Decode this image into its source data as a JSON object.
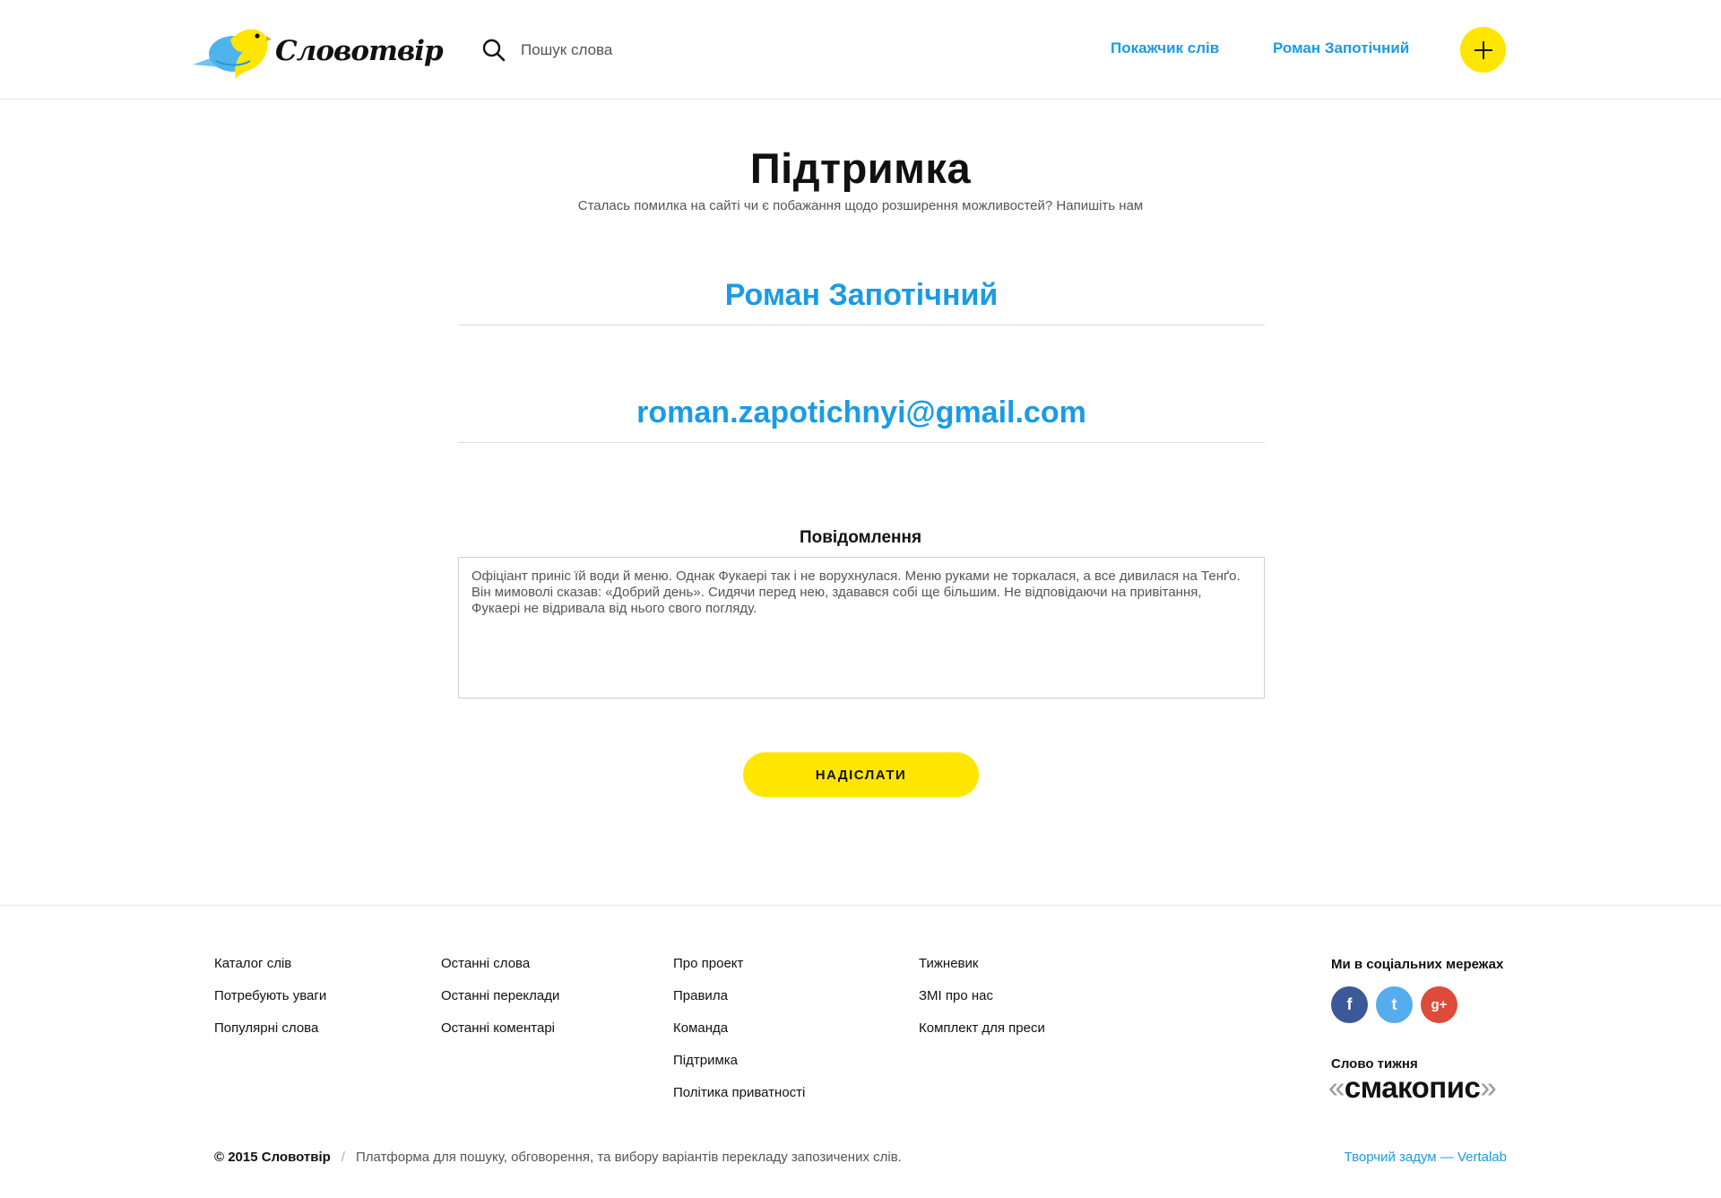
{
  "header": {
    "logo_text": "Словотвір",
    "search": {
      "placeholder": "Пошук слова",
      "value": ""
    },
    "nav": {
      "index_link": "Покажчик слів",
      "user_link": "Роман Запотічний"
    }
  },
  "main": {
    "title": "Підтримка",
    "subtitle": "Сталась помилка на сайті чи є побажання щодо розширення можливостей? Напишіть нам",
    "name_value": "Роман Запотічний",
    "email_value": "roman.zapotichnyi@gmail.com",
    "message_label": "Повідомлення",
    "message_value": "Офіціант приніс їй води й меню. Однак Фукаері так і не ворухнулася. Меню руками не торкалася, а все дивилася на Тенґо. Він мимоволі сказав: «Добрий день». Сидячи перед нею, здавався собі ще більшим. Не відповідаючи на привітання, Фукаері не відривала від нього свого погляду.",
    "submit_label": "НАДІСЛАТИ"
  },
  "footer": {
    "col1": [
      "Каталог слів",
      "Потребують уваги",
      "Популярні слова"
    ],
    "col2": [
      "Останні слова",
      "Останні переклади",
      "Останні коментарі"
    ],
    "col3": [
      "Про проект",
      "Правила",
      "Команда",
      "Підтримка",
      "Політика приватності"
    ],
    "col4": [
      "Тижневик",
      "ЗМІ про нас",
      "Комплект для преси"
    ],
    "social_title": "Ми в соціальних мережах",
    "social": {
      "facebook": "f",
      "twitter": "t",
      "google": "g+"
    },
    "word_of_week_label": "Слово тижня",
    "word_of_week": "смакопис",
    "word_open_quote": "«",
    "word_close_quote": "»",
    "copyright_owner": "© 2015 Словотвір",
    "copyright_sep": "/",
    "copyright_desc": "Платформа для пошуку, обговорення, та вибору варіантів перекладу запозичених слів.",
    "credit": "Творчий задум — Vertalab"
  },
  "colors": {
    "accent_blue": "#1a9be6",
    "accent_yellow": "#ffe600",
    "facebook": "#3b5998",
    "twitter": "#55acee",
    "google": "#dd4b39"
  }
}
